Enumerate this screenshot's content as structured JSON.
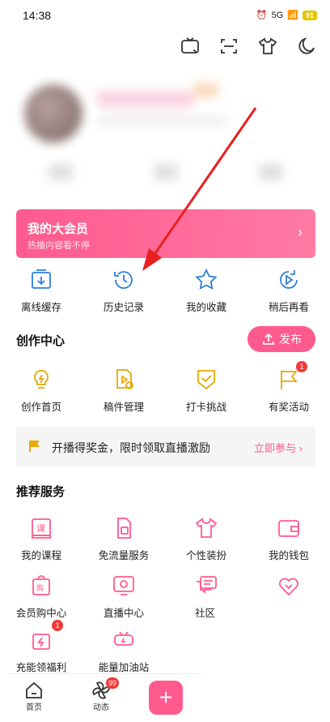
{
  "status_bar": {
    "time": "14:38",
    "signal": "5G",
    "battery": "91"
  },
  "top_icons": [
    "tv-cast-icon",
    "scan-icon",
    "shirt-icon",
    "moon-icon"
  ],
  "vip": {
    "title": "我的大会员",
    "subtitle": "热播内容看不停"
  },
  "quick_actions": [
    {
      "label": "离线缓存",
      "icon": "download-icon"
    },
    {
      "label": "历史记录",
      "icon": "history-icon"
    },
    {
      "label": "我的收藏",
      "icon": "star-icon"
    },
    {
      "label": "稍后再看",
      "icon": "play-later-icon"
    }
  ],
  "creation": {
    "title": "创作中心",
    "publish_label": "发布",
    "items": [
      {
        "label": "创作首页",
        "icon": "bulb-icon"
      },
      {
        "label": "稿件管理",
        "icon": "manuscript-icon"
      },
      {
        "label": "打卡挑战",
        "icon": "checkin-icon"
      },
      {
        "label": "有奖活动",
        "icon": "flag-icon",
        "badge": "1"
      }
    ]
  },
  "promo": {
    "text": "开播得奖金，限时领取直播激励",
    "link": "立即参与"
  },
  "services": {
    "title": "推荐服务",
    "row1": [
      {
        "label": "我的课程",
        "icon": "course-icon"
      },
      {
        "label": "免流量服务",
        "icon": "sim-icon"
      },
      {
        "label": "个性装扮",
        "icon": "shirt-icon"
      },
      {
        "label": "我的钱包",
        "icon": "wallet-icon"
      }
    ],
    "row2": [
      {
        "label": "会员购中心",
        "icon": "shop-bag-icon"
      },
      {
        "label": "直播中心",
        "icon": "live-icon"
      },
      {
        "label": "社区",
        "icon": "chat-icon"
      },
      {
        "label": "",
        "icon": "heart-icon"
      }
    ],
    "row3": [
      {
        "label": "充能领福利",
        "icon": "gift-icon",
        "badge": "1"
      },
      {
        "label": "能量加油站",
        "icon": "energy-icon"
      }
    ]
  },
  "bottom_nav": [
    {
      "label": "首页",
      "icon": "home-icon"
    },
    {
      "label": "动态",
      "icon": "pinwheel-icon",
      "badge": "99"
    }
  ],
  "colors": {
    "accent": "#ff5a8e",
    "icon_blue": "#2f7fd6",
    "icon_yellow": "#e8a800",
    "arrow": "#e82020"
  }
}
